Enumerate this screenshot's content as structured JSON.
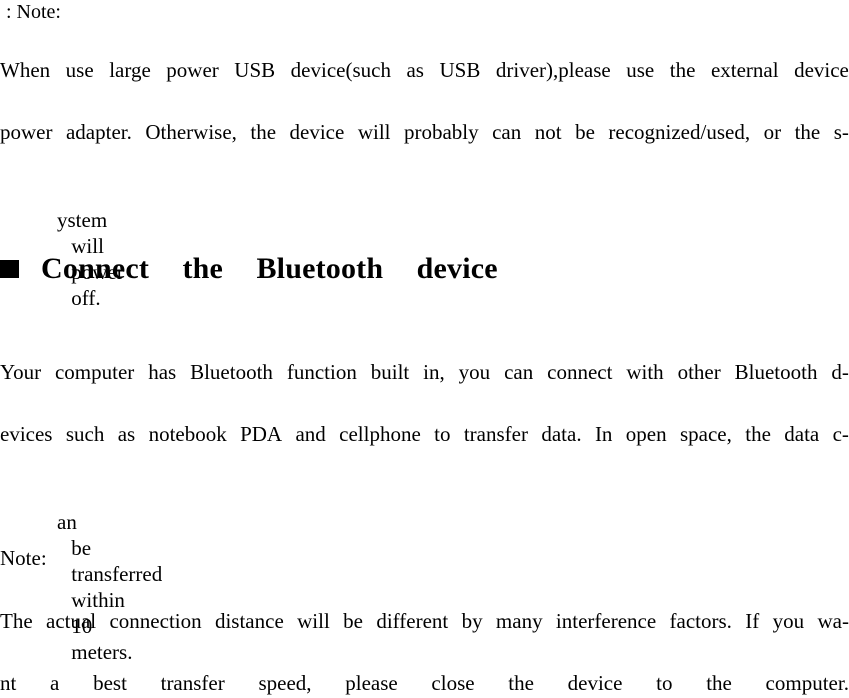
{
  "document": {
    "note_label_top": ": Note:",
    "paragraph_usb": {
      "lines": [
        [
          "When",
          "use",
          "large",
          "power",
          "USB",
          "device(such",
          "as",
          "USB",
          "driver),please",
          "use",
          "the",
          "external",
          "device"
        ],
        [
          "power",
          "adapter.",
          "Otherwise,",
          "the",
          "device",
          "will",
          "probably",
          "can",
          "not",
          "be",
          "recognized/used,",
          "or",
          "the",
          "s-"
        ],
        [
          "ystem",
          "will",
          "power",
          "off."
        ]
      ],
      "full_text": "When use large power USB device(such as USB driver),please use the external device power adapter. Otherwise, the device will probably can not be recognized/used, or the system will power off."
    },
    "heading": {
      "bullet": "■",
      "bullet_name": "filled-square-bullet",
      "text": "Connect  the  Bluetooth  device"
    },
    "paragraph_bluetooth": {
      "lines": [
        [
          "Your",
          "computer",
          "has",
          "Bluetooth",
          "function",
          "built",
          "in,",
          "you",
          "can",
          "connect",
          "with",
          "other",
          "Bluetooth",
          "d-"
        ],
        [
          "evices",
          "such",
          "as",
          "notebook",
          "PDA",
          "and",
          "cellphone",
          "to",
          "transfer",
          "data.",
          "In",
          "open",
          "space,",
          "the",
          "data",
          "c-"
        ],
        [
          "an",
          "be",
          "transferred",
          "within",
          "10",
          "meters."
        ]
      ],
      "full_text": "Your computer has Bluetooth function built in, you can connect with other Bluetooth devices such as notebook PDA and cellphone to transfer data. In open space, the data can be transferred within 10 meters."
    },
    "note_label_bottom": "Note:",
    "paragraph_note": {
      "lines": [
        [
          "The",
          "actual",
          "connection",
          "distance",
          "will",
          "be",
          "different",
          "by",
          "many",
          "interference",
          "factors.",
          "If",
          "you",
          "wa-"
        ],
        [
          "nt",
          "a",
          "best",
          "transfer",
          "speed,",
          "please",
          "close",
          "the",
          "device",
          "to",
          "the",
          "computer."
        ]
      ],
      "full_text": "The actual connection distance will be different by many interference factors. If you want a best transfer speed, please close the device to the computer."
    }
  },
  "colors": {
    "text": "#000000",
    "background": "#ffffff"
  }
}
